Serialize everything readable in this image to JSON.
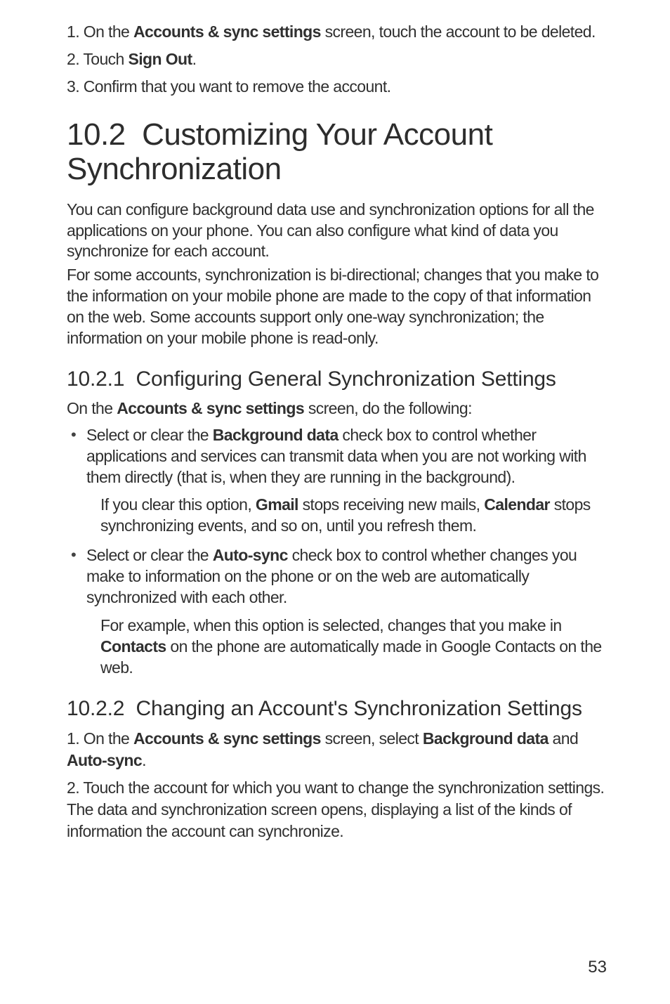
{
  "intro_steps": [
    {
      "num": "1.",
      "pre": "On the ",
      "bold": "Accounts & sync settings",
      "post": " screen, touch the account to be deleted."
    },
    {
      "num": "2.",
      "pre": "Touch ",
      "bold": "Sign Out",
      "post": "."
    },
    {
      "num": "3.",
      "pre": "Confirm that you want to remove the account.",
      "bold": "",
      "post": ""
    }
  ],
  "section": {
    "number": "10.2",
    "title": "Customizing Your Account Synchronization"
  },
  "paragraphs": [
    "You can configure background data use and synchronization options for all the applications on your phone. You can also configure what kind of data you synchronize for each account.",
    "For some accounts, synchronization is bi-directional; changes that you make to the information on your mobile phone are made to the copy of that information on the web. Some accounts support only one-way synchronization; the information on your mobile phone is read-only."
  ],
  "sub1": {
    "number": "10.2.1",
    "title": "Configuring General Synchronization Settings",
    "lead_pre": "On the ",
    "lead_bold": "Accounts & sync settings",
    "lead_post": " screen, do the following:",
    "bullets": [
      {
        "pre": "Select or clear the ",
        "bold": "Background data",
        "post": " check box to control whether applications and services can transmit data when you are not working with them directly (that is, when they are running in the background).",
        "sub_pre": "If you clear this option, ",
        "sub_b1": "Gmail",
        "sub_mid": " stops receiving new mails, ",
        "sub_b2": "Calendar",
        "sub_post": " stops synchronizing events, and so on, until you refresh them."
      },
      {
        "pre": "Select or clear the ",
        "bold": "Auto-sync",
        "post": " check box to control whether changes you make to information on the phone or on the web are automatically synchronized with each other.",
        "sub_pre": "For example, when this option is selected, changes that you make in ",
        "sub_b1": "Contacts",
        "sub_mid": "",
        "sub_b2": "",
        "sub_post": " on the phone are automatically made in Google Contacts on the web."
      }
    ]
  },
  "sub2": {
    "number": "10.2.2",
    "title": "Changing an Account's Synchronization Settings",
    "steps": [
      {
        "num": "1.",
        "parts": [
          {
            "t": "On the ",
            "b": false
          },
          {
            "t": "Accounts & sync settings",
            "b": true
          },
          {
            "t": " screen, select ",
            "b": false
          },
          {
            "t": "Background data",
            "b": true
          },
          {
            "t": " and ",
            "b": false
          },
          {
            "t": "Auto-sync",
            "b": true
          },
          {
            "t": ".",
            "b": false
          }
        ]
      },
      {
        "num": "2.",
        "parts": [
          {
            "t": "Touch the account for which you want to change the synchronization settings. The data and synchronization screen opens, displaying a list of the kinds of information the account can synchronize.",
            "b": false
          }
        ]
      }
    ]
  },
  "page_number": "53"
}
